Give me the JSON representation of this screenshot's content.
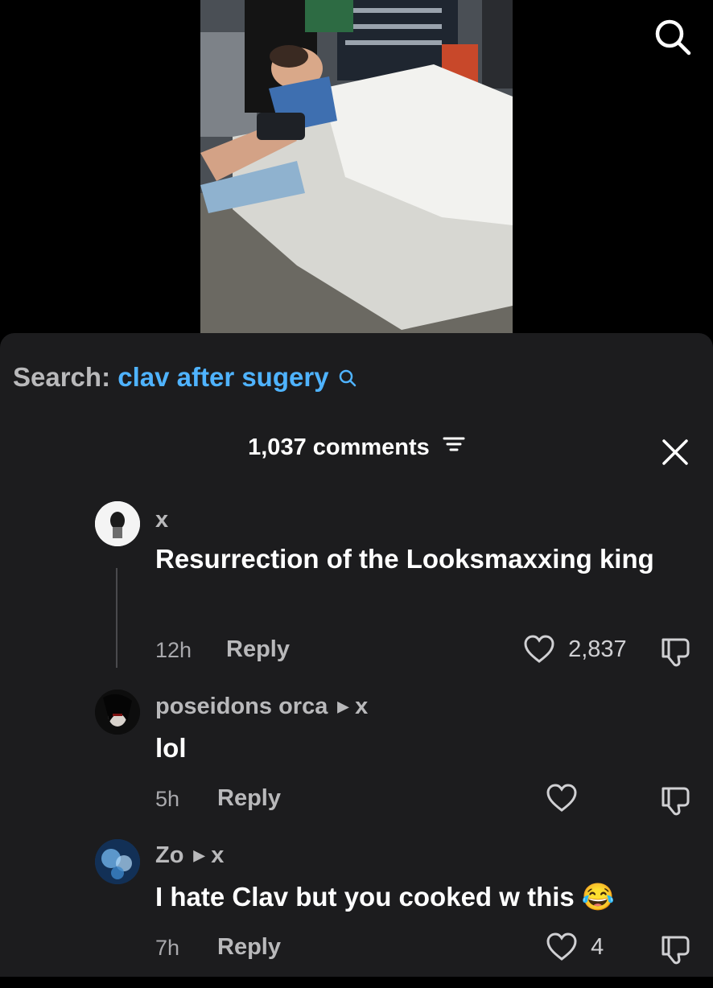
{
  "search": {
    "prefix": "Search:",
    "term": "clav after sugery"
  },
  "comments_header": {
    "count_label": "1,037 comments"
  },
  "comments": [
    {
      "username": "x",
      "text": "Resurrection of the Looksmaxxing king",
      "time": "12h",
      "reply_label": "Reply",
      "likes": "2,837"
    },
    {
      "username": "poseidons orca",
      "reply_to": "x",
      "text": "lol",
      "time": "5h",
      "reply_label": "Reply",
      "likes": ""
    },
    {
      "username": "Zo",
      "reply_to": "x",
      "text": "I hate Clav but you cooked w this 😂",
      "time": "7h",
      "reply_label": "Reply",
      "likes": "4"
    }
  ],
  "colors": {
    "accent": "#4fb3ff",
    "sheet_bg": "#1c1c1e",
    "muted": "#b9b9bb"
  },
  "icons": [
    "search-icon",
    "filter-icon",
    "close-icon",
    "heart-icon",
    "dislike-icon",
    "reply-arrow-icon"
  ]
}
